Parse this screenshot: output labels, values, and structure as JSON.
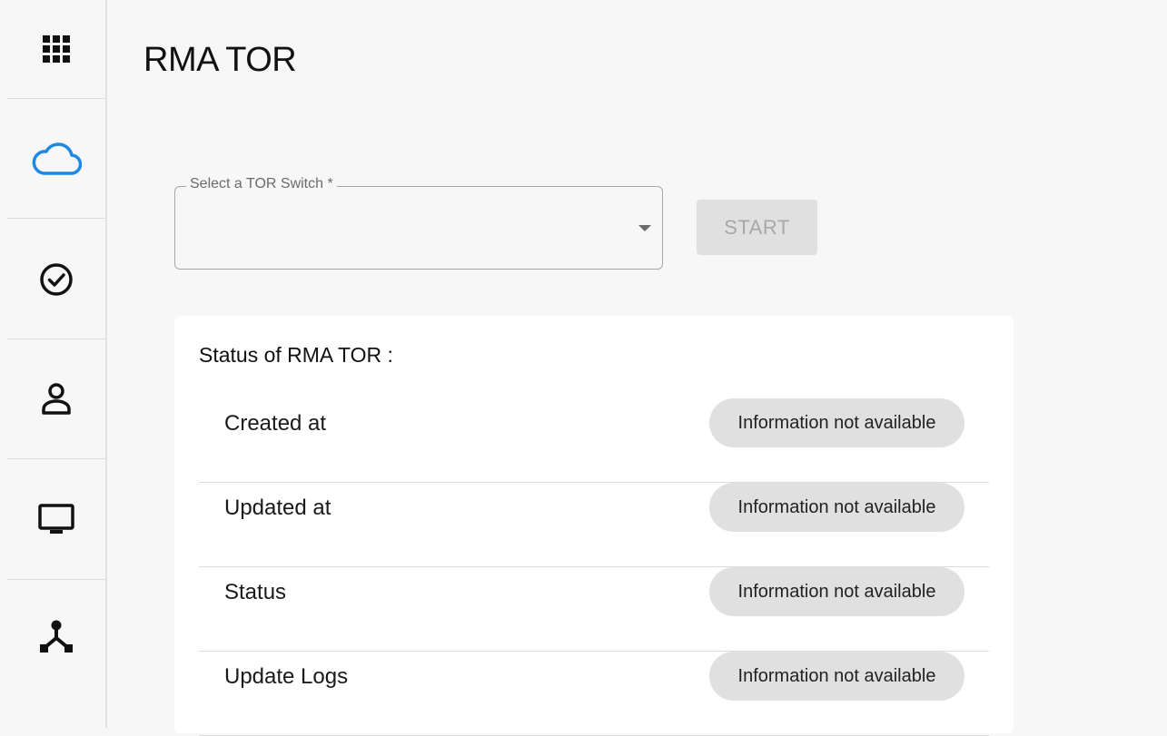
{
  "sidebar": {
    "items": [
      {
        "icon": "apps-grid-icon",
        "active": false
      },
      {
        "icon": "cloud-icon",
        "active": true
      },
      {
        "icon": "check-circle-icon",
        "active": false
      },
      {
        "icon": "person-icon",
        "active": false
      },
      {
        "icon": "monitor-icon",
        "active": false
      },
      {
        "icon": "network-tree-icon",
        "active": false
      }
    ],
    "active_color": "#1e88e5"
  },
  "page": {
    "title": "RMA TOR"
  },
  "form": {
    "select_label": "Select a TOR Switch *",
    "select_value": "",
    "start_label": "START"
  },
  "status": {
    "heading": "Status of RMA TOR :",
    "rows": [
      {
        "label": "Created at",
        "value": "Information not available"
      },
      {
        "label": "Updated at",
        "value": "Information not available"
      },
      {
        "label": "Status",
        "value": "Information not available"
      },
      {
        "label": "Update Logs",
        "value": "Information not available"
      }
    ]
  }
}
